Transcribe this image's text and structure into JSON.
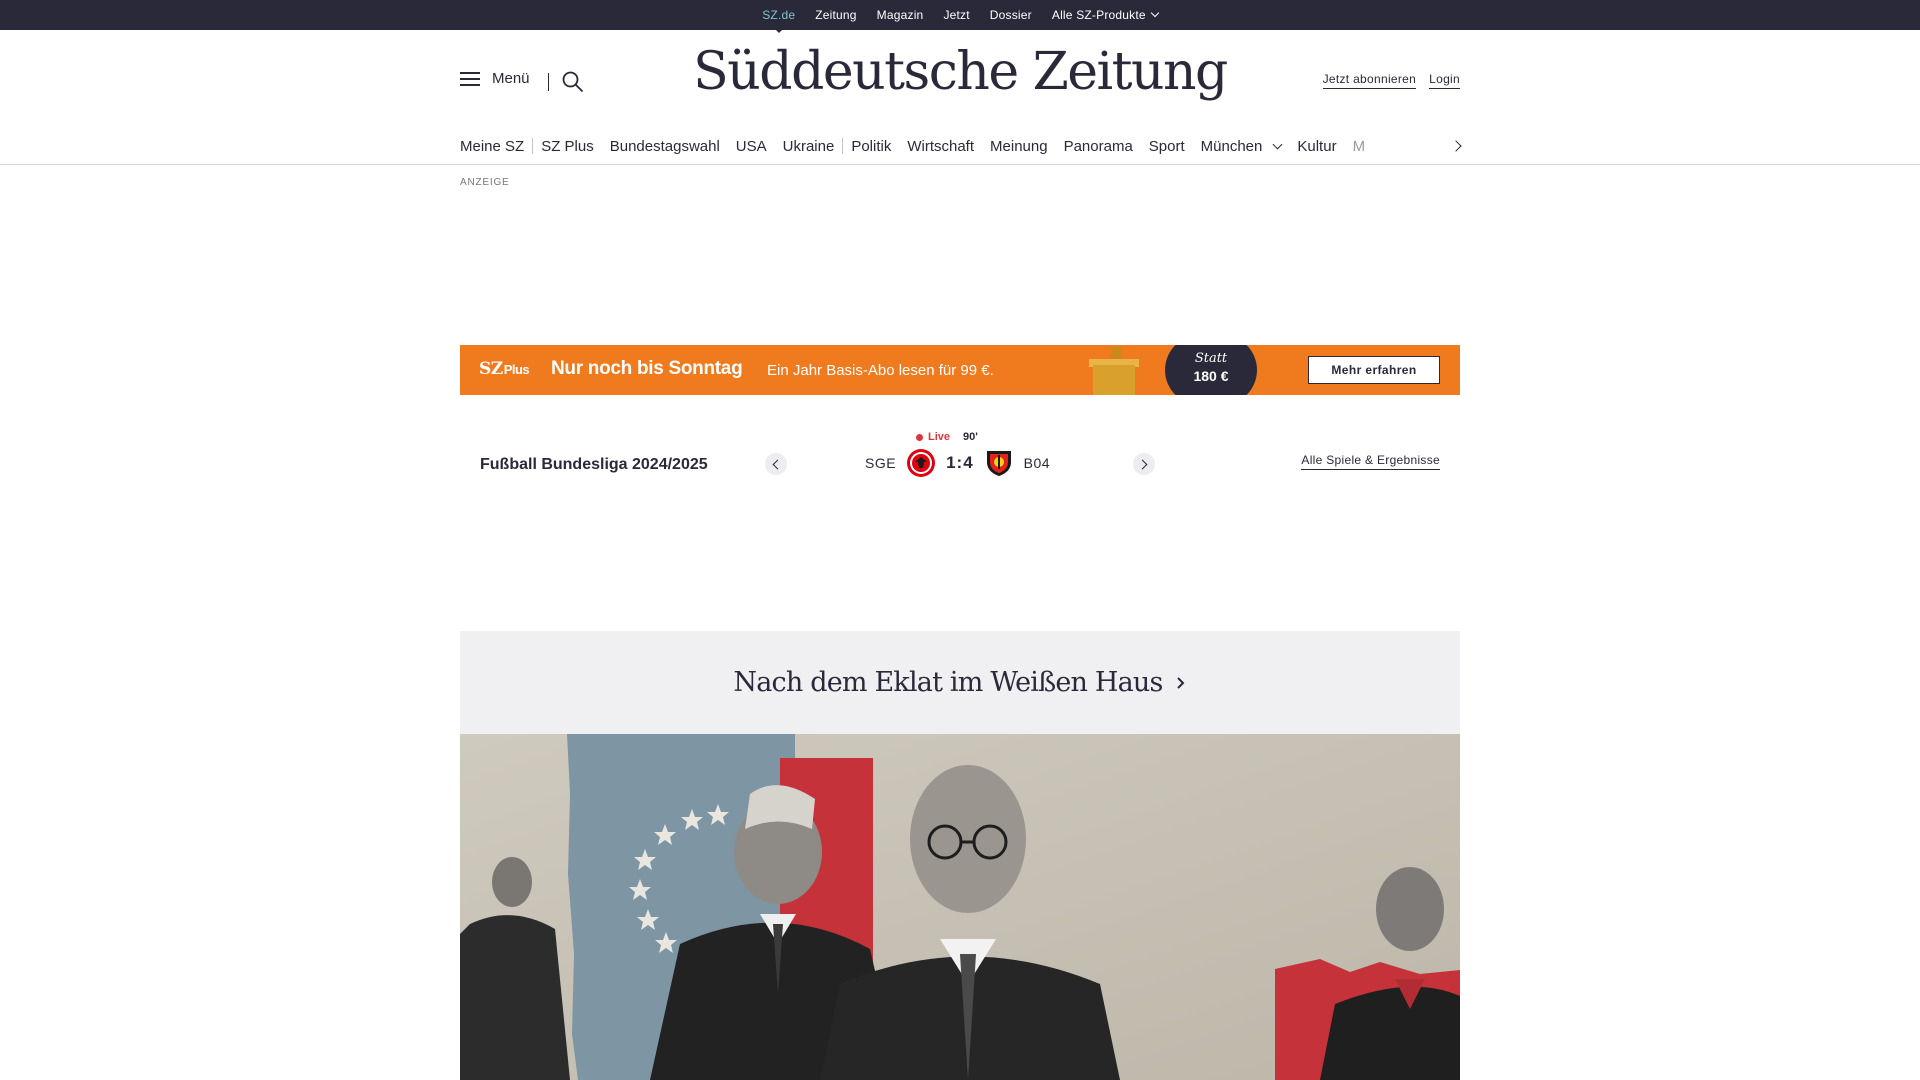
{
  "topbar": {
    "links": [
      "SZ.de",
      "Zeitung",
      "Magazin",
      "Jetzt",
      "Dossier",
      "Alle SZ-Produkte"
    ]
  },
  "header": {
    "menu_label": "Menü",
    "logo": "Süddeutsche Zeitung",
    "subscribe": "Jetzt abonnieren",
    "login": "Login"
  },
  "nav": {
    "items": [
      "Meine SZ",
      "SZ Plus",
      "Bundestagswahl",
      "USA",
      "Ukraine",
      "Politik",
      "Wirtschaft",
      "Meinung",
      "Panorama",
      "Sport",
      "München",
      "Kultur",
      "M"
    ]
  },
  "ad": {
    "label": "ANZEIGE"
  },
  "promo": {
    "logo_sz": "SZ",
    "logo_plus": "Plus",
    "headline": "Nur noch bis Sonntag",
    "subline": "Ein Jahr Basis-Abo lesen für 99 €.",
    "statt": "Statt",
    "old_price": "180 €",
    "button": "Mehr erfahren",
    "color": "#f07b1f"
  },
  "ticker": {
    "league": "Fußball Bundesliga 2024/2025",
    "live": "Live",
    "minute": "90'",
    "home": "SGE",
    "score": "1:4",
    "away": "B04",
    "all_games": "Alle Spiele & Ergebnisse",
    "live_color": "#e0343c"
  },
  "topic": {
    "title": "Nach dem Eklat im Weißen Haus"
  },
  "colors": {
    "dark": "#29293a",
    "accent": "#7fc4cc"
  }
}
